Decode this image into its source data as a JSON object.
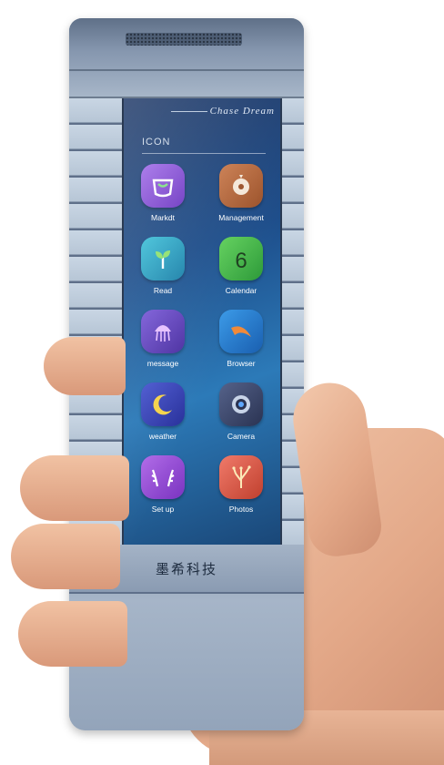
{
  "screen": {
    "brand": "Chase Dream",
    "section_title": "ICON",
    "apps": [
      {
        "label": "Markdt",
        "icon": "basket-icon",
        "color": "#8a4fd8"
      },
      {
        "label": "Management",
        "icon": "coin-icon",
        "color": "#b8673c"
      },
      {
        "label": "Read",
        "icon": "sprout-icon",
        "color": "#2a9fc0"
      },
      {
        "label": "Calendar",
        "icon": "calendar-six-icon",
        "color": "#43b54a"
      },
      {
        "label": "message",
        "icon": "jellyfish-icon",
        "color": "#6a4fc8"
      },
      {
        "label": "Browser",
        "icon": "swoosh-icon",
        "color": "#2b7fd0"
      },
      {
        "label": "weather",
        "icon": "moon-icon",
        "color": "#3a47b8"
      },
      {
        "label": "Camera",
        "icon": "camera-icon",
        "color": "#3d4a6a"
      },
      {
        "label": "Set up",
        "icon": "antler-icon",
        "color": "#9a4fd8"
      },
      {
        "label": "Photos",
        "icon": "coral-icon",
        "color": "#e05a4a"
      }
    ]
  },
  "device": {
    "logo_text": "墨希科技"
  }
}
